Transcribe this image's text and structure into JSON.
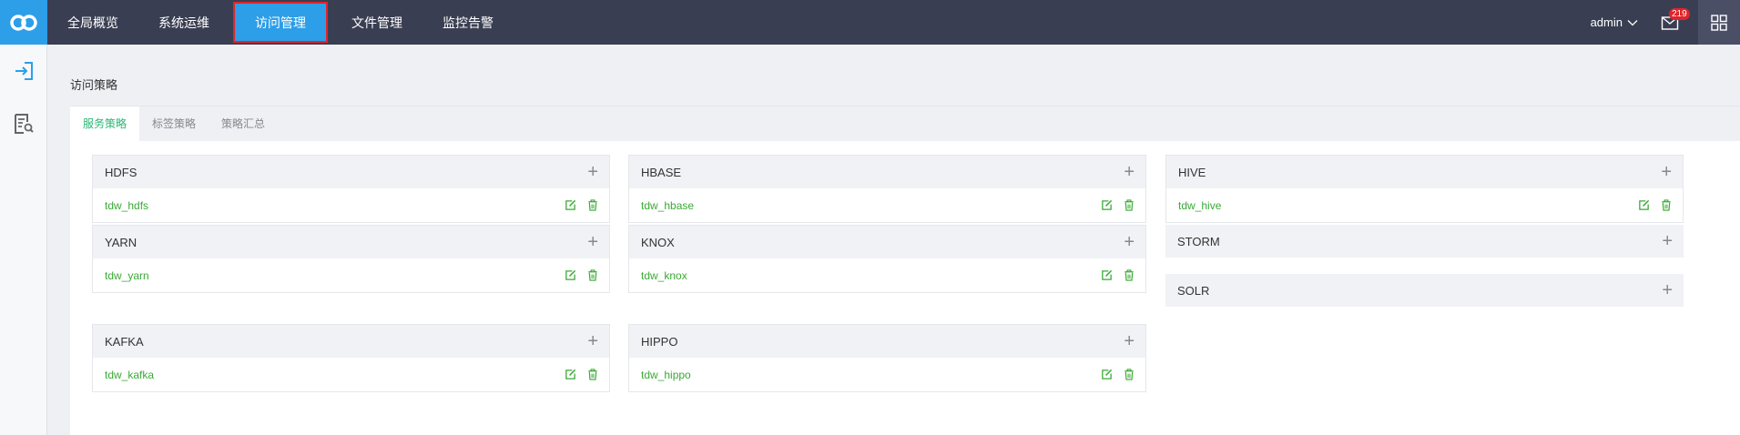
{
  "nav": {
    "logo": "co-logo-icon",
    "items": [
      {
        "label": "全局概览"
      },
      {
        "label": "系统运维"
      },
      {
        "label": "访问管理"
      },
      {
        "label": "文件管理"
      },
      {
        "label": "监控告警"
      }
    ],
    "active_index": 2,
    "user": "admin",
    "mail_badge": "219"
  },
  "sidebar": {
    "items": [
      {
        "icon": "login-arrow-icon"
      },
      {
        "icon": "document-search-icon"
      }
    ]
  },
  "page": {
    "title": "访问策略",
    "tabs": [
      {
        "label": "服务策略"
      },
      {
        "label": "标签策略"
      },
      {
        "label": "策略汇总"
      }
    ],
    "active_tab": 0
  },
  "services": [
    {
      "name": "HDFS",
      "policies": [
        "tdw_hdfs"
      ]
    },
    {
      "name": "HBASE",
      "policies": [
        "tdw_hbase"
      ]
    },
    {
      "name": "HIVE",
      "policies": [
        "tdw_hive"
      ]
    },
    {
      "name": "YARN",
      "policies": [
        "tdw_yarn"
      ]
    },
    {
      "name": "KNOX",
      "policies": [
        "tdw_knox"
      ]
    },
    {
      "name": "STORM",
      "policies": []
    },
    {
      "name": "SOLR",
      "policies": []
    },
    {
      "name": "KAFKA",
      "policies": [
        "tdw_kafka"
      ]
    },
    {
      "name": "HIPPO",
      "policies": [
        "tdw_hippo"
      ]
    }
  ],
  "colors": {
    "topbar": "#3a3e52",
    "accent_blue": "#2d9ee8",
    "policy_green": "#3aaa35",
    "highlight_red": "#e0242b"
  }
}
